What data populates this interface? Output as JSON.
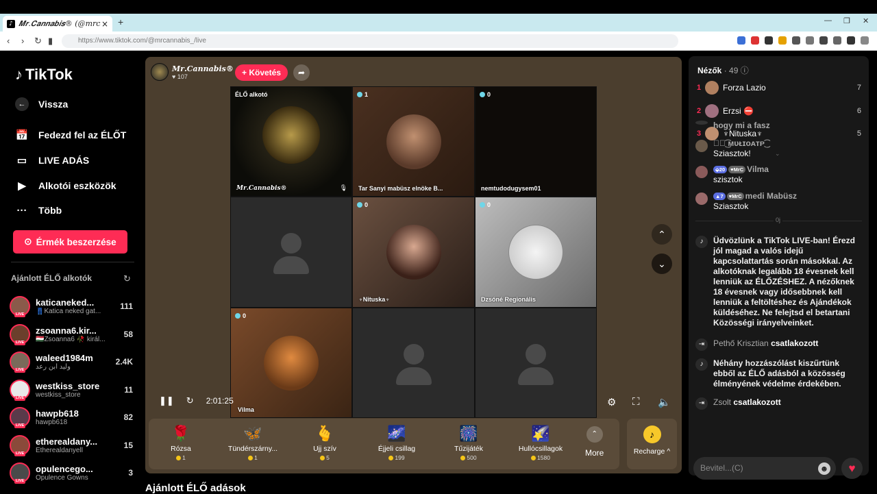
{
  "browser": {
    "tab_title": "𝑴𝒓.𝑪𝒂𝒏𝒏𝒂𝒃𝒊𝒔® (@mrcan",
    "new_tab": "+",
    "url": "https://www.tiktok.com/@mrcannabis_/live"
  },
  "sidebar": {
    "logo": "TikTok",
    "back": "Vissza",
    "nav": [
      {
        "label": "Fedezd fel az ÉLŐT",
        "icon": "calendar-live-icon"
      },
      {
        "label": "LIVE ADÁS",
        "icon": "camera-icon"
      },
      {
        "label": "Alkotói eszközök",
        "icon": "creator-tools-icon"
      },
      {
        "label": "Több",
        "icon": "more-dots-icon"
      }
    ],
    "coins_button": "Érmék beszerzése",
    "recommended_title": "Ajánlott ÉLŐ alkotók",
    "creators": [
      {
        "name": "katicaneked...",
        "sub": "👖Katica neked gat...",
        "count": "111",
        "color": "#8a5a4a"
      },
      {
        "name": "zsoanna6.kir...",
        "sub": "🇭🇺Zsoanna6 🥀 királ...",
        "count": "58",
        "color": "#6b3f2c"
      },
      {
        "name": "waleed1984m",
        "sub": "وليد ابن رعد",
        "count": "2.4K",
        "color": "#7a6a5a"
      },
      {
        "name": "westkiss_store",
        "sub": "westkiss_store",
        "count": "11",
        "color": "#e8e8e8"
      },
      {
        "name": "hawpb618",
        "sub": "hawpb618",
        "count": "82",
        "color": "#5a3a4a"
      },
      {
        "name": "etherealdany...",
        "sub": "Etherealdanyell",
        "count": "15",
        "color": "#8a4a3a"
      },
      {
        "name": "opulencego...",
        "sub": "Opulence Gowns",
        "count": "3",
        "color": "#4a4a4a"
      }
    ],
    "live_tag": "LIVE"
  },
  "player": {
    "host_name": "𝑴𝒓.𝑪𝒂𝒏𝒏𝒂𝒃𝒊𝒔®",
    "host_likes": "107",
    "follow": "+ Követés",
    "cells": [
      {
        "tag": "ÉLŐ alkotó",
        "label": "𝑴𝒓.𝑪𝒂𝒏𝒏𝒂𝒃𝒊𝒔®",
        "kind": "host"
      },
      {
        "tag": "1",
        "label": "Tar Sanyi mabüsz elnöke B...",
        "kind": "photo"
      },
      {
        "tag": "0",
        "label": "nemtudodugysem01",
        "kind": "dark"
      },
      {
        "tag": "",
        "label": "",
        "kind": "empty"
      },
      {
        "tag": "0",
        "label": "♆Nituska♆",
        "kind": "photo2"
      },
      {
        "tag": "0",
        "label": "Dzsóné Regionális",
        "kind": "logo"
      },
      {
        "tag": "0",
        "label": "Vilma",
        "kind": "photo3"
      },
      {
        "tag": "",
        "label": "",
        "kind": "empty"
      },
      {
        "tag": "",
        "label": "",
        "kind": "empty"
      }
    ],
    "time": "2:01:25",
    "gifts": [
      {
        "name": "Rózsa",
        "price": "1",
        "icon": "🌹"
      },
      {
        "name": "Tündérszárny...",
        "price": "1",
        "icon": "🦋"
      },
      {
        "name": "Ujj szív",
        "price": "5",
        "icon": "🫰"
      },
      {
        "name": "Éjjeli csillag",
        "price": "199",
        "icon": "🌌"
      },
      {
        "name": "Tűzijáték",
        "price": "500",
        "icon": "🎆"
      },
      {
        "name": "Hullócsillagok",
        "price": "1580",
        "icon": "🌠"
      }
    ],
    "more": "More",
    "recharge": "Recharge ^"
  },
  "below_title": "Ajánlott ÉLŐ adások",
  "panel": {
    "viewers_label": "Nézők",
    "viewers_count": "· 49",
    "top_viewers": [
      {
        "rank": "1",
        "name": "Forza Lazio",
        "score": "7",
        "color": "#b08060"
      },
      {
        "rank": "2",
        "name": "Erzsi ⛔",
        "score": "6",
        "color": "#a07080"
      },
      {
        "rank": "3",
        "name": "♆Nituska♆",
        "score": "5",
        "color": "#c09070"
      }
    ],
    "messages": [
      {
        "name": "",
        "text": "hogy mi a fasz",
        "badge1": "",
        "badge2": ""
      },
      {
        "name": "ঔৣ͜͡ ᴍᴜᴌɪᴏᴀᴛᴘ͜͡",
        "text": "Sziasztok!",
        "badge1": "",
        "badge2": ""
      },
      {
        "name": "Vilma",
        "text": "szisztok",
        "badge1": "20",
        "badge2": "MrC"
      },
      {
        "name": "medi Mabüsz",
        "text": "Sziasztok",
        "badge1": "7",
        "badge2": "MrC"
      }
    ],
    "separator": "0j",
    "welcome": "Üdvözlünk a TikTok LIVE-ban! Érezd jól magad a valós idejű kapcsolattartás során másokkal. Az alkotóknak legalább 18 évesnek kell lenniük az ÉLŐZÉSHEZ. A nézőknek 18 évesnek vagy idősebbnek kell lenniük a feltöltéshez és Ajándékok küldéséhez. Ne felejtsd el betartani Közösségi irányelveinket.",
    "joined1_who": "Pethő Krisztian",
    "joined_label": "csatlakozott",
    "filter_notice": "Néhány hozzászólást kiszűrtünk ebből az ÉLŐ adásból a közösség élményének védelme érdekében.",
    "joined2_who": "Zsolt",
    "input_placeholder": "Bevitel...(C)"
  }
}
